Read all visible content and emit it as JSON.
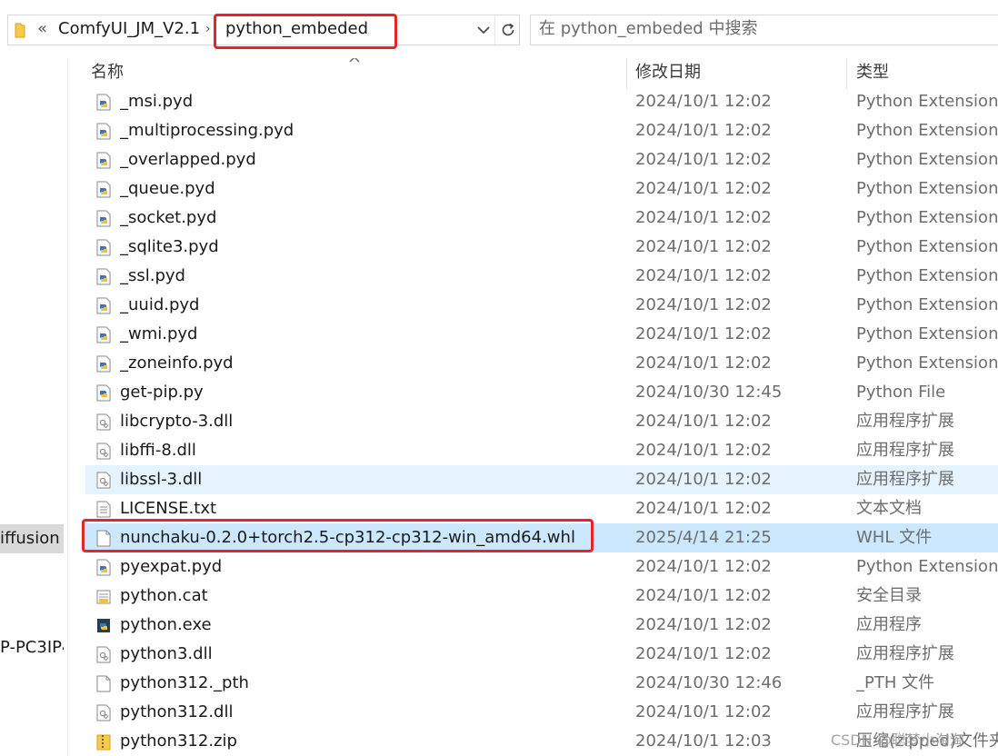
{
  "address_bar": {
    "overflow_glyph": "«",
    "crumbs": [
      "ComfyUI_JM_V2.1",
      "python_embeded"
    ],
    "separator": "›",
    "search_placeholder": "在 python_embeded 中搜索"
  },
  "nav_pane": {
    "items": [
      {
        "label": "iffusion",
        "selected": true
      },
      {
        "label": "P-PC3IP4",
        "selected": false
      }
    ]
  },
  "columns": {
    "name": "名称",
    "date": "修改日期",
    "type": "类型"
  },
  "files": [
    {
      "name": "_msi.pyd",
      "date": "2024/10/1 12:02",
      "type": "Python Extension ...",
      "icon": "python-extension-icon"
    },
    {
      "name": "_multiprocessing.pyd",
      "date": "2024/10/1 12:02",
      "type": "Python Extension ...",
      "icon": "python-extension-icon"
    },
    {
      "name": "_overlapped.pyd",
      "date": "2024/10/1 12:02",
      "type": "Python Extension ...",
      "icon": "python-extension-icon"
    },
    {
      "name": "_queue.pyd",
      "date": "2024/10/1 12:02",
      "type": "Python Extension ...",
      "icon": "python-extension-icon"
    },
    {
      "name": "_socket.pyd",
      "date": "2024/10/1 12:02",
      "type": "Python Extension ...",
      "icon": "python-extension-icon"
    },
    {
      "name": "_sqlite3.pyd",
      "date": "2024/10/1 12:02",
      "type": "Python Extension ...",
      "icon": "python-extension-icon"
    },
    {
      "name": "_ssl.pyd",
      "date": "2024/10/1 12:02",
      "type": "Python Extension ...",
      "icon": "python-extension-icon"
    },
    {
      "name": "_uuid.pyd",
      "date": "2024/10/1 12:02",
      "type": "Python Extension ...",
      "icon": "python-extension-icon"
    },
    {
      "name": "_wmi.pyd",
      "date": "2024/10/1 12:02",
      "type": "Python Extension ...",
      "icon": "python-extension-icon"
    },
    {
      "name": "_zoneinfo.pyd",
      "date": "2024/10/1 12:02",
      "type": "Python Extension ...",
      "icon": "python-extension-icon"
    },
    {
      "name": "get-pip.py",
      "date": "2024/10/30 12:45",
      "type": "Python File",
      "icon": "python-file-icon"
    },
    {
      "name": "libcrypto-3.dll",
      "date": "2024/10/1 12:02",
      "type": "应用程序扩展",
      "icon": "dll-icon"
    },
    {
      "name": "libffi-8.dll",
      "date": "2024/10/1 12:02",
      "type": "应用程序扩展",
      "icon": "dll-icon"
    },
    {
      "name": "libssl-3.dll",
      "date": "2024/10/1 12:02",
      "type": "应用程序扩展",
      "icon": "dll-icon",
      "state": "hover"
    },
    {
      "name": "LICENSE.txt",
      "date": "2024/10/1 12:02",
      "type": "文本文档",
      "icon": "text-file-icon"
    },
    {
      "name": "nunchaku-0.2.0+torch2.5-cp312-cp312-win_amd64.whl",
      "date": "2025/4/14 21:25",
      "type": "WHL 文件",
      "icon": "blank-file-icon",
      "state": "selected"
    },
    {
      "name": "pyexpat.pyd",
      "date": "2024/10/1 12:02",
      "type": "Python Extension ...",
      "icon": "python-extension-icon"
    },
    {
      "name": "python.cat",
      "date": "2024/10/1 12:02",
      "type": "安全目录",
      "icon": "security-catalog-icon"
    },
    {
      "name": "python.exe",
      "date": "2024/10/1 12:02",
      "type": "应用程序",
      "icon": "python-exe-icon"
    },
    {
      "name": "python3.dll",
      "date": "2024/10/1 12:02",
      "type": "应用程序扩展",
      "icon": "dll-icon"
    },
    {
      "name": "python312._pth",
      "date": "2024/10/30 12:46",
      "type": "_PTH 文件",
      "icon": "blank-file-icon"
    },
    {
      "name": "python312.dll",
      "date": "2024/10/1 12:02",
      "type": "应用程序扩展",
      "icon": "dll-icon"
    },
    {
      "name": "python312.zip",
      "date": "2024/10/1 12:03",
      "type": "压缩(zipped)文件夹",
      "icon": "zip-folder-icon"
    }
  ],
  "watermark": "CSDN @聪梦小淘淘",
  "colors": {
    "highlight": "#e8232a",
    "selected_row": "#cce8ff",
    "hover_row": "#e5f3ff",
    "nav_selected": "#d9d9d9"
  }
}
